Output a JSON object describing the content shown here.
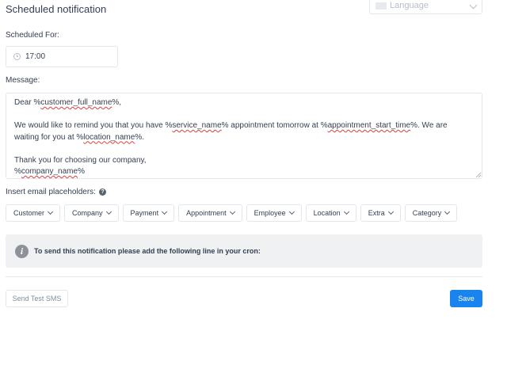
{
  "header": {
    "title": "Scheduled notification"
  },
  "language_select": {
    "placeholder": "Language"
  },
  "scheduled_for": {
    "label": "Scheduled For:",
    "value": "17:00"
  },
  "message": {
    "label": "Message:",
    "line1_pre": "Dear %",
    "line1_ph": "customer_full_name",
    "line1_post": "%,",
    "line2_pre": "We would like to remind you that you have %",
    "line2_ph1": "service_name",
    "line2_mid": "% appointment tomorrow at %",
    "line2_ph2": "appointment_start_time",
    "line2_post": "%. We are waiting for you at %",
    "line2_ph3": "location_name",
    "line2_end": "%.",
    "line3": "Thank you for choosing our company,",
    "line4_pre": "%",
    "line4_ph": "company_name",
    "line4_post": "%"
  },
  "placeholders": {
    "label": "Insert email placeholders:",
    "buttons": [
      "Customer",
      "Company",
      "Payment",
      "Appointment",
      "Employee",
      "Location",
      "Extra",
      "Category"
    ]
  },
  "cron": {
    "text": "To send this notification please add the following line in your cron:"
  },
  "actions": {
    "send_test": "Send Test SMS",
    "save": "Save"
  },
  "colors": {
    "primary": "#1a84ee",
    "text": "#354052",
    "border": "#e1e6ef",
    "info_bg": "#f0f1f3"
  }
}
